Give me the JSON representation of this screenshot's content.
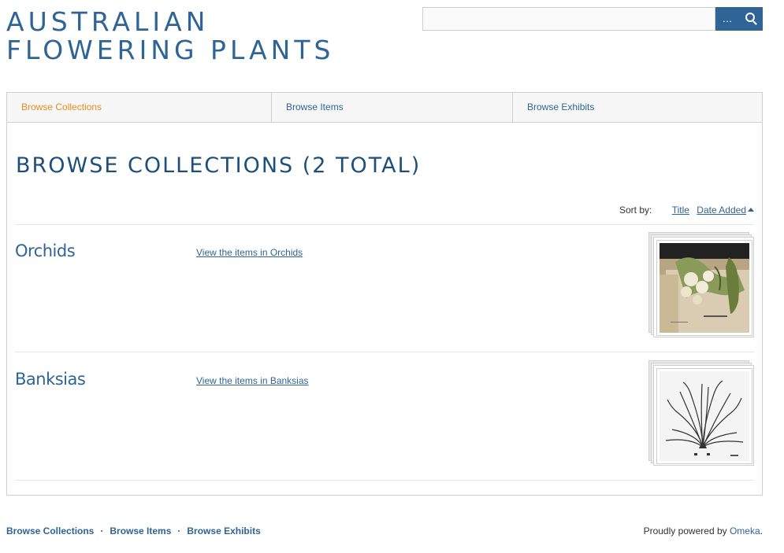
{
  "site": {
    "title_line1": "AUSTRALIAN",
    "title_line2": "FLOWERING PLANTS"
  },
  "search": {
    "value": "",
    "placeholder": "",
    "options_label": "…"
  },
  "nav": {
    "items": [
      {
        "label": "Browse Collections",
        "active": true
      },
      {
        "label": "Browse Items",
        "active": false
      },
      {
        "label": "Browse Exhibits",
        "active": false
      }
    ]
  },
  "page": {
    "heading": "Browse Collections (2 total)"
  },
  "sort": {
    "label": "Sort by:",
    "title_label": "Title",
    "date_label": "Date Added"
  },
  "collections": [
    {
      "title": "Orchids",
      "link": "View the items in Orchids",
      "thumb_icon": "orchid-illustration"
    },
    {
      "title": "Banksias",
      "link": "View the items in Banksias",
      "thumb_icon": "banksia-sketch"
    }
  ],
  "footer": {
    "links": [
      "Browse Collections",
      "Browse Items",
      "Browse Exhibits"
    ],
    "separator": "·",
    "powered_prefix": "Proudly powered by ",
    "powered_link": "Omeka",
    "powered_suffix": "."
  },
  "colors": {
    "accent": "#2f6496",
    "active_nav": "#e88a1e"
  }
}
